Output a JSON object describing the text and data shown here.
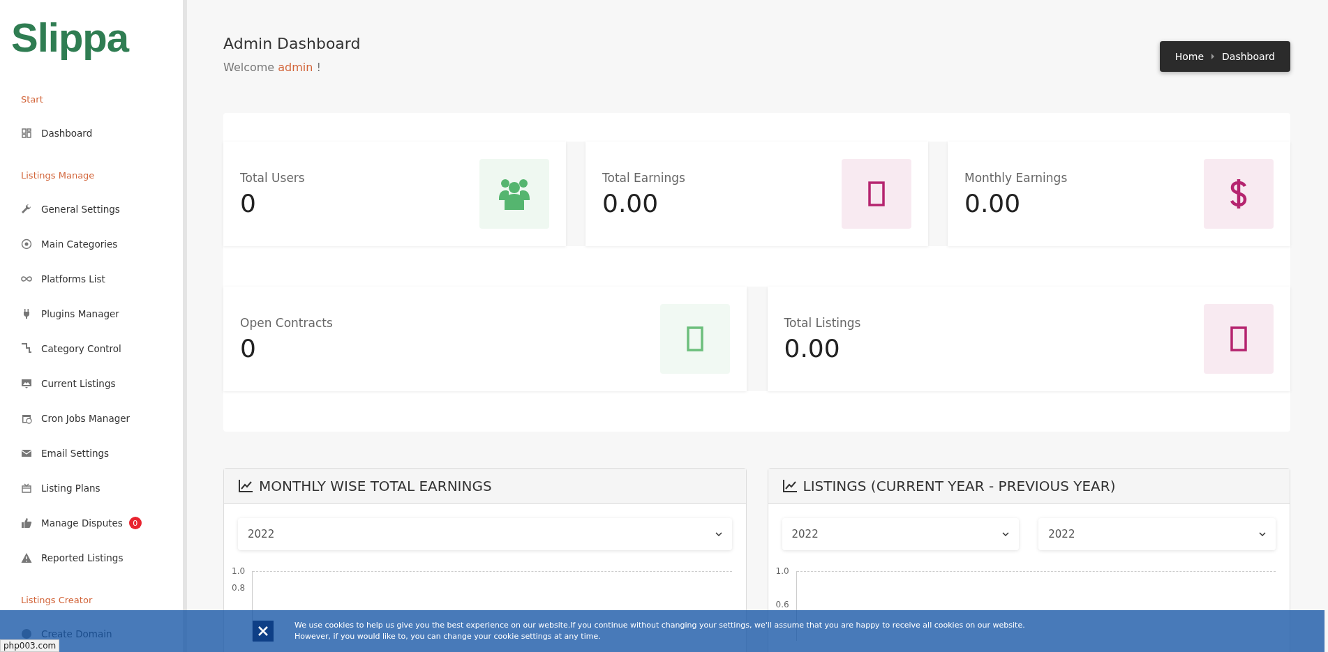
{
  "brand": "Slippa",
  "sidebar": {
    "sections": [
      {
        "heading": "Start",
        "items": [
          {
            "label": "Dashboard",
            "kind": "grid"
          }
        ]
      },
      {
        "heading": "Listings Manage",
        "items": [
          {
            "label": "General Settings",
            "kind": "wrench"
          },
          {
            "label": "Main Categories",
            "kind": "target"
          },
          {
            "label": "Platforms List",
            "kind": "infinity"
          },
          {
            "label": "Plugins Manager",
            "kind": "plug"
          },
          {
            "label": "Category Control",
            "kind": "steps"
          },
          {
            "label": "Current Listings",
            "kind": "monitor"
          },
          {
            "label": "Cron Jobs Manager",
            "kind": "calendar"
          },
          {
            "label": "Email Settings",
            "kind": "mail"
          },
          {
            "label": "Listing Plans",
            "kind": "gift"
          },
          {
            "label": "Manage Disputes",
            "kind": "thumb",
            "badge": "0"
          },
          {
            "label": "Reported Listings",
            "kind": "warning"
          }
        ]
      },
      {
        "heading": "Listings Creator",
        "items": [
          {
            "label": "Create Domain",
            "kind": "globe"
          }
        ]
      }
    ]
  },
  "header": {
    "title": "Admin Dashboard",
    "welcome_prefix": "Welcome",
    "user": "admin",
    "welcome_suffix": "!"
  },
  "breadcrumb": [
    {
      "label": "Home"
    },
    {
      "label": "Dashboard"
    }
  ],
  "stats_rows": [
    [
      {
        "label": "Total Users",
        "value": "0",
        "kind": "users",
        "color": "#55b56f"
      },
      {
        "label": "Total Earnings",
        "value": "0.00",
        "kind": "box",
        "color": "#b5246f"
      },
      {
        "label": "Monthly Earnings",
        "value": "0.00",
        "kind": "dollar",
        "color": "#b5246f"
      }
    ],
    [
      {
        "label": "Open Contracts",
        "value": "0",
        "kind": "box",
        "color": "#6cbf7c"
      },
      {
        "label": "Total Listings",
        "value": "0.00",
        "kind": "box",
        "color": "#b5246f"
      }
    ]
  ],
  "charts": [
    {
      "title": "MONTHLY WISE TOTAL EARNINGS",
      "selects": [
        "2022"
      ],
      "y_tick_labels": [
        "1.0",
        "0.8"
      ]
    },
    {
      "title": "LISTINGS (CURRENT YEAR - PREVIOUS YEAR)",
      "selects": [
        "2022",
        "2022"
      ],
      "y_tick_labels": [
        "1.0",
        "0.6"
      ]
    }
  ],
  "cookie_bar": {
    "text": "We use cookies to help us give you the best experience on our website.If you continue without changing your settings, we'll assume that you are happy to receive all cookies on our website. However, if you would like to, you can change your cookie settings at any time."
  },
  "status_link": "php003.com"
}
